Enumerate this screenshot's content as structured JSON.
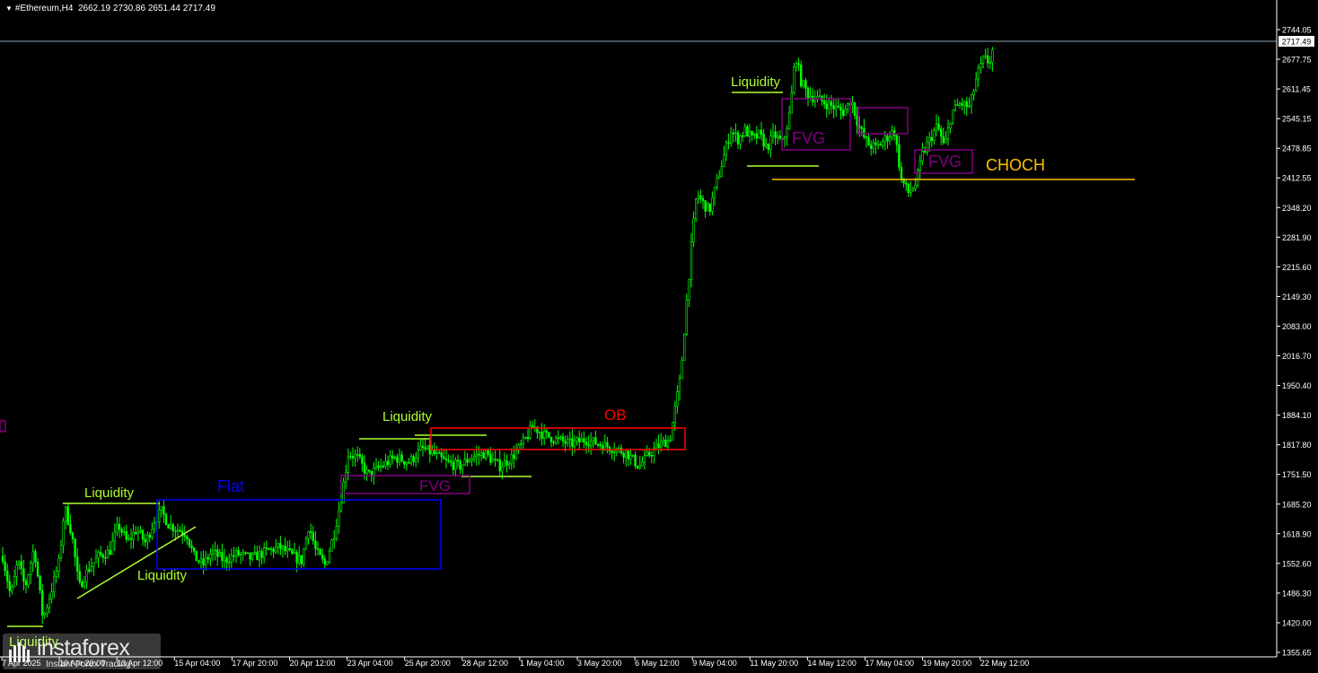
{
  "header": {
    "symbol": "#Ethereum,H4",
    "ohlc": "2662.19 2730.86 2651.44 2717.49"
  },
  "logo": {
    "name": "instaforex",
    "tagline": "Instant Forex Trading"
  },
  "chart_data": {
    "type": "candlestick",
    "symbol": "#Ethereum",
    "timeframe": "H4",
    "current_price": 2717.49,
    "current_price_label": "2717.49",
    "ylim": [
      1330,
      2770
    ],
    "y_ticks": [
      "2744.05",
      "2677.75",
      "2611.45",
      "2545.15",
      "2478.85",
      "2412.55",
      "2348.20",
      "2281.90",
      "2215.60",
      "2149.30",
      "2083.00",
      "2016.70",
      "1950.40",
      "1884.10",
      "1817.80",
      "1751.50",
      "1685.20",
      "1618.90",
      "1552.60",
      "1486.30",
      "1420.00",
      "1355.65"
    ],
    "x_ticks": [
      "7 Apr 2025",
      "10 Apr 20:00",
      "13 Apr 12:00",
      "15 Apr 04:00",
      "17 Apr 20:00",
      "20 Apr 12:00",
      "23 Apr 04:00",
      "25 Apr 20:00",
      "28 Apr 12:00",
      "1 May 04:00",
      "3 May 20:00",
      "6 May 12:00",
      "9 May 04:00",
      "11 May 20:00",
      "14 May 12:00",
      "17 May 04:00",
      "19 May 20:00",
      "22 May 12:00"
    ],
    "price_path": [
      [
        0,
        1600
      ],
      [
        12,
        1480
      ],
      [
        20,
        1560
      ],
      [
        28,
        1500
      ],
      [
        38,
        1590
      ],
      [
        48,
        1430
      ],
      [
        58,
        1500
      ],
      [
        66,
        1560
      ],
      [
        72,
        1680
      ],
      [
        80,
        1620
      ],
      [
        88,
        1500
      ],
      [
        98,
        1540
      ],
      [
        110,
        1570
      ],
      [
        122,
        1580
      ],
      [
        132,
        1640
      ],
      [
        142,
        1600
      ],
      [
        152,
        1630
      ],
      [
        162,
        1600
      ],
      [
        172,
        1650
      ],
      [
        180,
        1670
      ],
      [
        188,
        1640
      ],
      [
        198,
        1630
      ],
      [
        208,
        1620
      ],
      [
        216,
        1570
      ],
      [
        226,
        1550
      ],
      [
        236,
        1580
      ],
      [
        250,
        1560
      ],
      [
        264,
        1575
      ],
      [
        280,
        1565
      ],
      [
        296,
        1580
      ],
      [
        312,
        1590
      ],
      [
        326,
        1570
      ],
      [
        336,
        1560
      ],
      [
        344,
        1640
      ],
      [
        352,
        1580
      ],
      [
        362,
        1550
      ],
      [
        372,
        1620
      ],
      [
        380,
        1700
      ],
      [
        388,
        1800
      ],
      [
        398,
        1790
      ],
      [
        410,
        1750
      ],
      [
        424,
        1770
      ],
      [
        440,
        1790
      ],
      [
        456,
        1780
      ],
      [
        470,
        1810
      ],
      [
        482,
        1800
      ],
      [
        496,
        1780
      ],
      [
        512,
        1770
      ],
      [
        524,
        1790
      ],
      [
        540,
        1800
      ],
      [
        556,
        1770
      ],
      [
        570,
        1790
      ],
      [
        582,
        1820
      ],
      [
        594,
        1860
      ],
      [
        606,
        1840
      ],
      [
        620,
        1830
      ],
      [
        636,
        1820
      ],
      [
        652,
        1830
      ],
      [
        668,
        1820
      ],
      [
        684,
        1810
      ],
      [
        698,
        1800
      ],
      [
        712,
        1770
      ],
      [
        724,
        1800
      ],
      [
        736,
        1820
      ],
      [
        746,
        1830
      ],
      [
        752,
        1900
      ],
      [
        758,
        1970
      ],
      [
        764,
        2120
      ],
      [
        770,
        2260
      ],
      [
        776,
        2380
      ],
      [
        782,
        2360
      ],
      [
        790,
        2340
      ],
      [
        798,
        2400
      ],
      [
        806,
        2460
      ],
      [
        814,
        2520
      ],
      [
        822,
        2500
      ],
      [
        830,
        2520
      ],
      [
        838,
        2500
      ],
      [
        846,
        2510
      ],
      [
        854,
        2480
      ],
      [
        862,
        2510
      ],
      [
        872,
        2490
      ],
      [
        880,
        2560
      ],
      [
        886,
        2690
      ],
      [
        892,
        2630
      ],
      [
        900,
        2600
      ],
      [
        910,
        2590
      ],
      [
        920,
        2580
      ],
      [
        930,
        2570
      ],
      [
        940,
        2560
      ],
      [
        948,
        2590
      ],
      [
        956,
        2530
      ],
      [
        966,
        2490
      ],
      [
        976,
        2480
      ],
      [
        986,
        2500
      ],
      [
        996,
        2520
      ],
      [
        1004,
        2410
      ],
      [
        1012,
        2380
      ],
      [
        1020,
        2400
      ],
      [
        1028,
        2470
      ],
      [
        1036,
        2500
      ],
      [
        1044,
        2530
      ],
      [
        1052,
        2480
      ],
      [
        1060,
        2560
      ],
      [
        1070,
        2580
      ],
      [
        1080,
        2570
      ],
      [
        1088,
        2640
      ],
      [
        1096,
        2680
      ],
      [
        1102,
        2670
      ],
      [
        1108,
        2717
      ]
    ]
  },
  "annotations": {
    "liquidity_1": "Liquidity",
    "liquidity_2": "Liquidity",
    "liquidity_3": "Liquidity",
    "liquidity_4": "Liquidity",
    "liquidity_5": "Liquidity",
    "flat": "Flat",
    "fvg_1": "FVG",
    "fvg_2": "FVG",
    "fvg_3": "FVG",
    "ob": "OB",
    "choch": "CHOCH"
  },
  "colors": {
    "background": "#000000",
    "candle": "#00ff00",
    "axis": "#ffffff",
    "liquidity": "#adff2f",
    "flat": "#0000ff",
    "fvg": "#800080",
    "ob": "#ff0000",
    "choch": "#ffc000",
    "price_line": "#8fa3b8"
  }
}
